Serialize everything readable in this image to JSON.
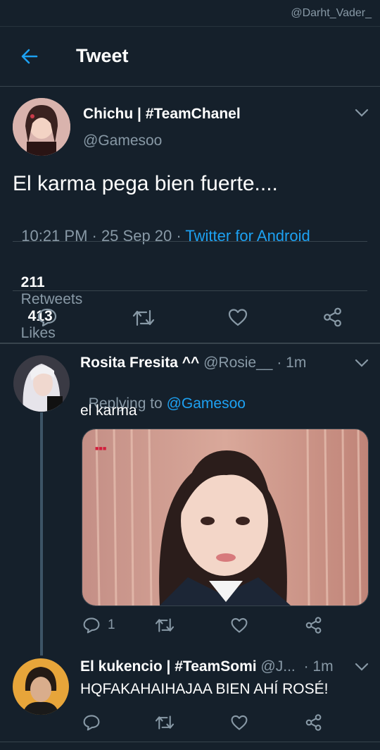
{
  "watermark": "@Darht_Vader_",
  "header": {
    "title": "Tweet"
  },
  "main_tweet": {
    "name": "Chichu | #TeamChanel",
    "handle": "@Gamesoo",
    "text": "El karma pega bien fuerte....",
    "time": "10:21 PM · 25 Sep 20 · ",
    "source": "Twitter for Android",
    "retweets_count": "211",
    "retweets_label": "Retweets",
    "likes_count": "413",
    "likes_label": "Likes"
  },
  "replies": [
    {
      "name": "Rosita Fresita ^^",
      "handle": "@Rosie__",
      "time": "· 1m",
      "replying_prefix": "Replying to ",
      "replying_handle": "@Gamesoo",
      "text": "el karma",
      "reply_count": "1",
      "media_icon": "video-thumbnail-girl"
    },
    {
      "name": "El kukencio | #TeamSomi",
      "handle": "@J...",
      "time": "· 1m",
      "text": "HQFAKAHAIHAJAA BIEN AHÍ ROSÉ!"
    }
  ],
  "colors": {
    "background": "#15202b",
    "accent": "#1da1f2",
    "muted": "#8899a6",
    "divider": "#38444d"
  }
}
